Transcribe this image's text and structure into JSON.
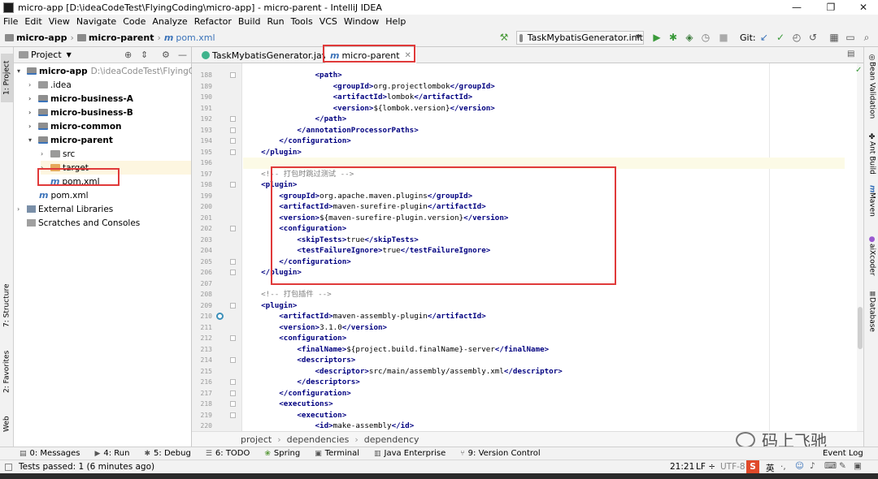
{
  "window": {
    "title": "micro-app [D:\\ideaCodeTest\\FlyingCoding\\micro-app] - micro-parent - IntelliJ IDEA",
    "controls": [
      "—",
      "❐",
      "✕"
    ]
  },
  "menu": [
    "File",
    "Edit",
    "View",
    "Navigate",
    "Code",
    "Analyze",
    "Refactor",
    "Build",
    "Run",
    "Tools",
    "VCS",
    "Window",
    "Help"
  ],
  "navbar": {
    "crumbs": [
      "micro-app",
      "micro-parent",
      "pom.xml"
    ],
    "run_config": "TaskMybatisGenerator.init",
    "git_label": "Git:"
  },
  "left_stripe": [
    "1: Project",
    "7: Structure",
    "2: Favorites",
    "Web"
  ],
  "project_panel": {
    "header": "Project",
    "tree": [
      {
        "label": "micro-app",
        "path": "D:\\ideaCodeTest\\FlyingCoding",
        "bold": true,
        "arrow": "▾"
      },
      {
        "label": ".idea",
        "bold": false,
        "arrow": "›"
      },
      {
        "label": "micro-business-A",
        "bold": true,
        "arrow": "›"
      },
      {
        "label": "micro-business-B",
        "bold": true,
        "arrow": "›"
      },
      {
        "label": "micro-common",
        "bold": true,
        "arrow": "›"
      },
      {
        "label": "micro-parent",
        "bold": true,
        "arrow": "▾"
      },
      {
        "label": "src",
        "bold": false,
        "arrow": "›"
      },
      {
        "label": "target",
        "bold": false,
        "arrow": "›"
      },
      {
        "label": "pom.xml",
        "bold": false,
        "arrow": ""
      },
      {
        "label": "pom.xml",
        "bold": false,
        "arrow": ""
      },
      {
        "label": "External Libraries",
        "bold": false,
        "arrow": "›"
      },
      {
        "label": "Scratches and Consoles",
        "bold": false,
        "arrow": ""
      }
    ]
  },
  "editor": {
    "tabs": [
      {
        "label": "TaskMybatisGenerator.java",
        "active": false
      },
      {
        "label": "micro-parent",
        "active": true
      }
    ],
    "lines": [
      {
        "n": "188",
        "t": "                <path>"
      },
      {
        "n": "189",
        "t": "                    <groupId>org.projectlombok</groupId>"
      },
      {
        "n": "190",
        "t": "                    <artifactId>lombok</artifactId>"
      },
      {
        "n": "191",
        "t": "                    <version>${lombok.version}</version>"
      },
      {
        "n": "192",
        "t": "                </path>"
      },
      {
        "n": "193",
        "t": "            </annotationProcessorPaths>"
      },
      {
        "n": "194",
        "t": "        </configuration>"
      },
      {
        "n": "195",
        "t": "    </plugin>"
      },
      {
        "n": "196",
        "t": ""
      },
      {
        "n": "197",
        "t": "    <!-- 打包时跳过测试 -->"
      },
      {
        "n": "198",
        "t": "    <plugin>"
      },
      {
        "n": "199",
        "t": "        <groupId>org.apache.maven.plugins</groupId>"
      },
      {
        "n": "200",
        "t": "        <artifactId>maven-surefire-plugin</artifactId>"
      },
      {
        "n": "201",
        "t": "        <version>${maven-surefire-plugin.version}</version>"
      },
      {
        "n": "202",
        "t": "        <configuration>"
      },
      {
        "n": "203",
        "t": "            <skipTests>true</skipTests>"
      },
      {
        "n": "204",
        "t": "            <testFailureIgnore>true</testFailureIgnore>"
      },
      {
        "n": "205",
        "t": "        </configuration>"
      },
      {
        "n": "206",
        "t": "    </plugin>"
      },
      {
        "n": "207",
        "t": ""
      },
      {
        "n": "208",
        "t": "    <!-- 打包插件 -->"
      },
      {
        "n": "209",
        "t": "    <plugin>"
      },
      {
        "n": "210",
        "t": "        <artifactId>maven-assembly-plugin</artifactId>"
      },
      {
        "n": "211",
        "t": "        <version>3.1.0</version>"
      },
      {
        "n": "212",
        "t": "        <configuration>"
      },
      {
        "n": "213",
        "t": "            <finalName>${project.build.finalName}-server</finalName>"
      },
      {
        "n": "214",
        "t": "            <descriptors>"
      },
      {
        "n": "215",
        "t": "                <descriptor>src/main/assembly/assembly.xml</descriptor>"
      },
      {
        "n": "216",
        "t": "            </descriptors>"
      },
      {
        "n": "217",
        "t": "        </configuration>"
      },
      {
        "n": "218",
        "t": "        <executions>"
      },
      {
        "n": "219",
        "t": "            <execution>"
      },
      {
        "n": "220",
        "t": "                <id>make-assembly</id>"
      }
    ],
    "breadcrumbs": [
      "project",
      "dependencies",
      "dependency"
    ]
  },
  "right_stripe": [
    "Bean Validation",
    "Ant Build",
    "Maven",
    "aiXcoder",
    "Database"
  ],
  "bottom_tools": [
    {
      "label": "0: Messages",
      "icon": "▤"
    },
    {
      "label": "4: Run",
      "icon": "▶"
    },
    {
      "label": "5: Debug",
      "icon": "✱"
    },
    {
      "label": "6: TODO",
      "icon": "☰"
    },
    {
      "label": "Spring",
      "icon": "❀"
    },
    {
      "label": "Terminal",
      "icon": "▣"
    },
    {
      "label": "Java Enterprise",
      "icon": "▥"
    },
    {
      "label": "9: Version Control",
      "icon": "⑂"
    }
  ],
  "status": {
    "message": "Tests passed: 1 (6 minutes ago)",
    "position": "21:21",
    "line_sep": "LF ÷",
    "encoding": "UTF-8",
    "ime": "英"
  },
  "watermark": "码上飞驰",
  "event_log": "Event Log",
  "colors": {
    "accent": "#3b73b9",
    "highlight": "#e03a3a",
    "tag": "#000080"
  }
}
